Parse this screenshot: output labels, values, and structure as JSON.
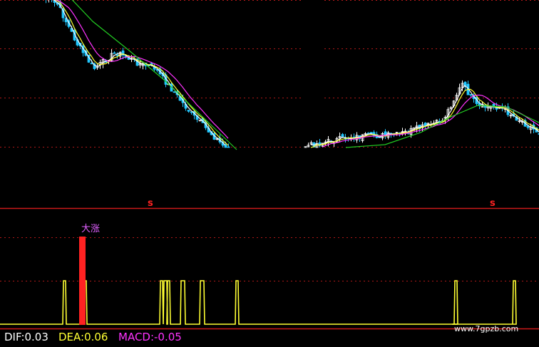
{
  "chart_data": [
    {
      "type": "candlestick",
      "title": "",
      "grid": true,
      "series": [
        {
          "name": "",
          "color": "#ffffff"
        },
        {
          "name": "",
          "color": "#ffff33"
        },
        {
          "name": "",
          "color": "#ff33ff"
        },
        {
          "name": "",
          "color": "#22cc22"
        }
      ],
      "markers": [
        {
          "text": "s",
          "color": "#ff2222",
          "bar_index": 38
        },
        {
          "text": "s",
          "color": "#ff2222",
          "bar_index": 158
        }
      ]
    },
    {
      "type": "bar",
      "title": "",
      "signal_label": "大涨",
      "series": [
        {
          "name": "",
          "color": "#ffff33",
          "spike_bars": [
            22,
            28,
            57,
            58,
            59,
            64,
            70,
            83,
            160,
            180
          ]
        },
        {
          "name": "",
          "color": "#ff2222",
          "spike_bars": [
            29
          ]
        }
      ]
    }
  ],
  "indicator": {
    "dif": "DIF:0.03",
    "dea": "DEA:0.06",
    "macd": "MACD:-0.05"
  },
  "colors": {
    "background": "#000000",
    "grid": "#b01818",
    "divider": "#cc1a1a",
    "up": "#ffffff",
    "down": "#22c8ff",
    "ma5": "#ffffff",
    "ma10": "#ffff33",
    "ma20": "#ff33ff",
    "ma60": "#22cc22",
    "signal_yellow": "#ffff33",
    "signal_red": "#ff2222"
  },
  "watermark": "www.7gpzb.com"
}
